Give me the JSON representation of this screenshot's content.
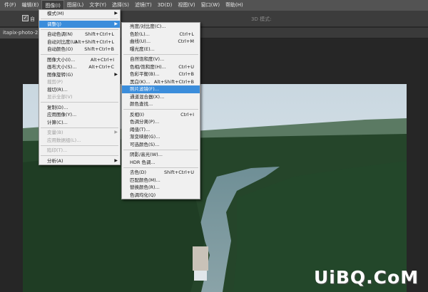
{
  "menubar": {
    "items": [
      {
        "label": "件(F)"
      },
      {
        "label": "编辑(E)"
      },
      {
        "label": "图像(I)",
        "active": true
      },
      {
        "label": "图层(L)"
      },
      {
        "label": "文字(Y)"
      },
      {
        "label": "选择(S)"
      },
      {
        "label": "滤镜(T)"
      },
      {
        "label": "3D(D)"
      },
      {
        "label": "视图(V)"
      },
      {
        "label": "窗口(W)"
      },
      {
        "label": "帮助(H)"
      }
    ]
  },
  "options_bar": {
    "checkbox_label": "自",
    "mode_label": "3D 模式:"
  },
  "document_tab": {
    "label": "itapix-photo-25"
  },
  "image_menu": {
    "items": [
      {
        "label": "模式(M)",
        "shortcut": "",
        "submenu": true,
        "disabled": false
      },
      {
        "sep": true
      },
      {
        "label": "调整(J)",
        "shortcut": "",
        "submenu": true,
        "disabled": false,
        "highlighted": true
      },
      {
        "sep": true
      },
      {
        "label": "自动色调(N)",
        "shortcut": "Shift+Ctrl+L",
        "disabled": false
      },
      {
        "label": "自动对比度(U)",
        "shortcut": "Alt+Shift+Ctrl+L",
        "disabled": false
      },
      {
        "label": "自动颜色(O)",
        "shortcut": "Shift+Ctrl+B",
        "disabled": false
      },
      {
        "sep": true
      },
      {
        "label": "图像大小(I)...",
        "shortcut": "Alt+Ctrl+I",
        "disabled": false
      },
      {
        "label": "画布大小(S)...",
        "shortcut": "Alt+Ctrl+C",
        "disabled": false
      },
      {
        "label": "图像旋转(G)",
        "shortcut": "",
        "submenu": true,
        "disabled": false
      },
      {
        "label": "裁剪(P)",
        "shortcut": "",
        "disabled": true
      },
      {
        "label": "裁切(R)...",
        "shortcut": "",
        "disabled": false
      },
      {
        "label": "显示全部(V)",
        "shortcut": "",
        "disabled": true
      },
      {
        "sep": true
      },
      {
        "label": "复制(D)...",
        "shortcut": "",
        "disabled": false
      },
      {
        "label": "应用图像(Y)...",
        "shortcut": "",
        "disabled": false
      },
      {
        "label": "计算(C)...",
        "shortcut": "",
        "disabled": false
      },
      {
        "sep": true
      },
      {
        "label": "变量(B)",
        "shortcut": "",
        "submenu": true,
        "disabled": true
      },
      {
        "label": "应用数据组(L)...",
        "shortcut": "",
        "disabled": true
      },
      {
        "sep": true
      },
      {
        "label": "陷印(T)...",
        "shortcut": "",
        "disabled": true
      },
      {
        "sep": true
      },
      {
        "label": "分析(A)",
        "shortcut": "",
        "submenu": true,
        "disabled": false
      }
    ]
  },
  "adjust_menu": {
    "items": [
      {
        "label": "亮度/对比度(C)...",
        "shortcut": ""
      },
      {
        "label": "色阶(L)...",
        "shortcut": "Ctrl+L"
      },
      {
        "label": "曲线(U)...",
        "shortcut": "Ctrl+M"
      },
      {
        "label": "曝光度(E)...",
        "shortcut": ""
      },
      {
        "sep": true
      },
      {
        "label": "自然饱和度(V)...",
        "shortcut": ""
      },
      {
        "label": "色相/饱和度(H)...",
        "shortcut": "Ctrl+U"
      },
      {
        "label": "色彩平衡(B)...",
        "shortcut": "Ctrl+B"
      },
      {
        "label": "黑白(K)...",
        "shortcut": "Alt+Shift+Ctrl+B"
      },
      {
        "label": "照片滤镜(F)...",
        "shortcut": "",
        "highlighted": true
      },
      {
        "label": "通道混合器(X)...",
        "shortcut": ""
      },
      {
        "label": "颜色查找...",
        "shortcut": ""
      },
      {
        "sep": true
      },
      {
        "label": "反相(I)",
        "shortcut": "Ctrl+I"
      },
      {
        "label": "色调分离(P)...",
        "shortcut": ""
      },
      {
        "label": "阈值(T)...",
        "shortcut": ""
      },
      {
        "label": "渐变映射(G)...",
        "shortcut": ""
      },
      {
        "label": "可选颜色(S)...",
        "shortcut": ""
      },
      {
        "sep": true
      },
      {
        "label": "阴影/高光(W)...",
        "shortcut": ""
      },
      {
        "label": "HDR 色调...",
        "shortcut": ""
      },
      {
        "sep": true
      },
      {
        "label": "去色(D)",
        "shortcut": "Shift+Ctrl+U"
      },
      {
        "label": "匹配颜色(M)...",
        "shortcut": ""
      },
      {
        "label": "替换颜色(R)...",
        "shortcut": ""
      },
      {
        "label": "色调均化(Q)",
        "shortcut": ""
      }
    ]
  },
  "watermark": {
    "text": "UiBQ.CoM"
  }
}
